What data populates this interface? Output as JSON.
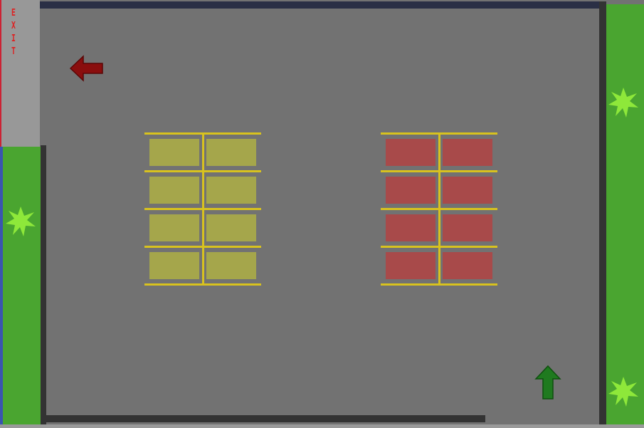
{
  "exit_sign": {
    "letters": [
      "E",
      "X",
      "I",
      "T"
    ]
  },
  "colors": {
    "asphalt": "#727272",
    "wall": "#333333",
    "top_wall": "#2a2f45",
    "grass": "#4aa530",
    "bush": "#8ee83a",
    "exit_zone": "#989898",
    "exit_text": "#d22222",
    "stripe_yellow": "#d8c21e",
    "slot_yellow": "#a5a64b",
    "slot_red": "#a84a4a",
    "arrow_red": "#8a0e0e",
    "arrow_green": "#1f7a1f"
  },
  "lots": [
    {
      "id": "yellow-lot",
      "slot_color": "slot_yellow",
      "rows": 4,
      "cols": 2
    },
    {
      "id": "red-lot",
      "slot_color": "slot_red",
      "rows": 4,
      "cols": 2
    }
  ],
  "icons": {
    "exit_arrow": "arrow-left-icon",
    "player_arrow": "arrow-up-icon",
    "bush": "bush-icon"
  }
}
